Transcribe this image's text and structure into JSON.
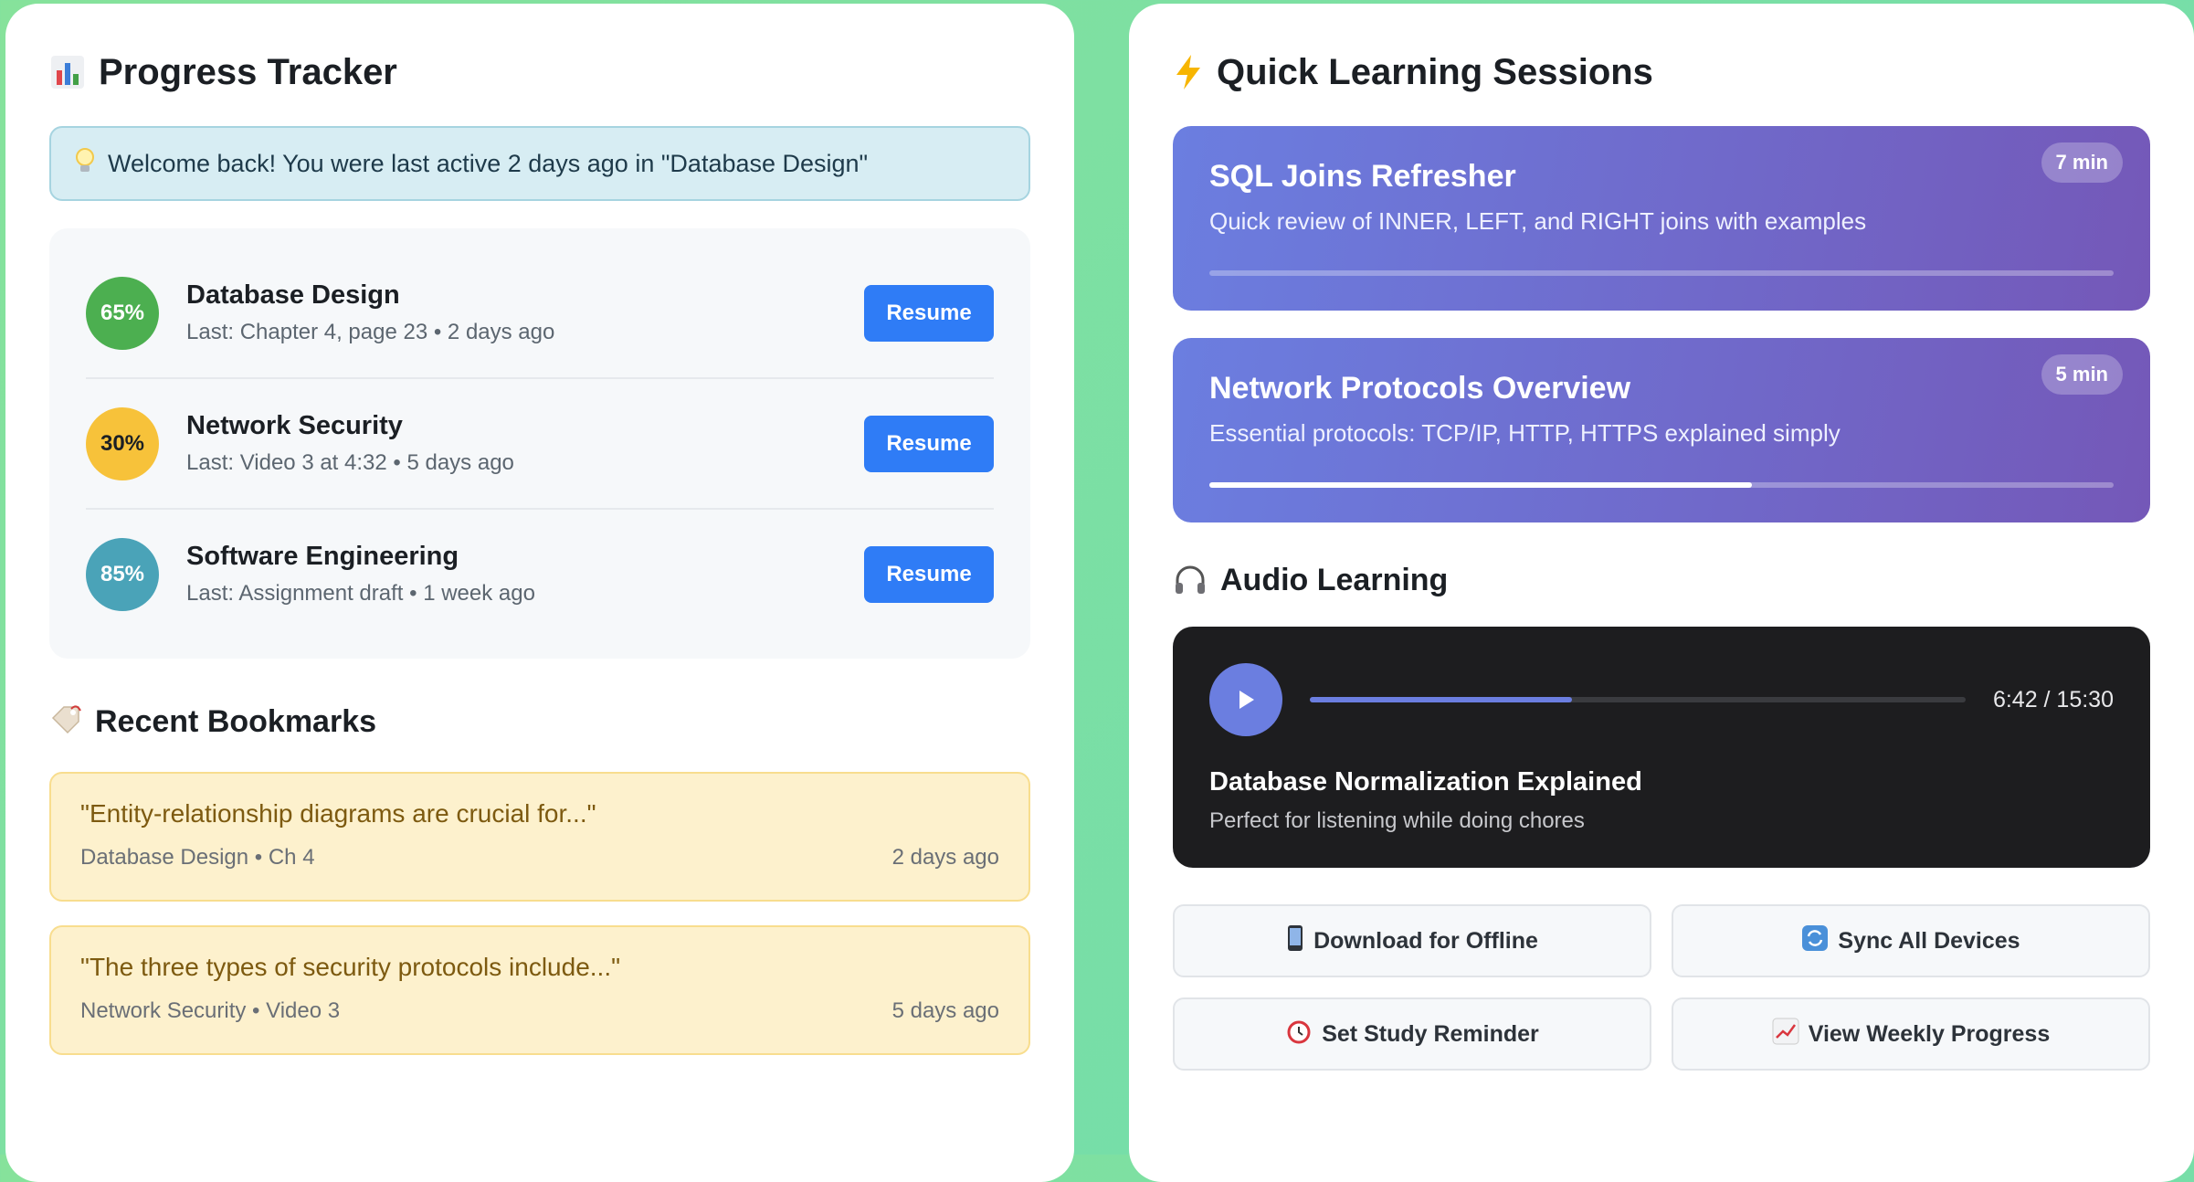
{
  "progress": {
    "title": "Progress Tracker",
    "icon": "bar-chart-icon",
    "welcome": "Welcome back! You were last active 2 days ago in \"Database Design\"",
    "courses": [
      {
        "percent": "65%",
        "name": "Database Design",
        "last": "Last: Chapter 4, page 23 • 2 days ago",
        "button": "Resume",
        "color": "#4caf50",
        "text_color": "#ffffff"
      },
      {
        "percent": "30%",
        "name": "Network Security",
        "last": "Last: Video 3 at 4:32 • 5 days ago",
        "button": "Resume",
        "color": "#f7c23a",
        "text_color": "#1b1f24"
      },
      {
        "percent": "85%",
        "name": "Software Engineering",
        "last": "Last: Assignment draft • 1 week ago",
        "button": "Resume",
        "color": "#4aa3b8",
        "text_color": "#ffffff"
      }
    ]
  },
  "bookmarks": {
    "title": "Recent Bookmarks",
    "icon": "bookmark-tag-icon",
    "items": [
      {
        "quote": "\"Entity-relationship diagrams are crucial for...\"",
        "source": "Database Design • Ch 4",
        "time": "2 days ago"
      },
      {
        "quote": "\"The three types of security protocols include...\"",
        "source": "Network Security • Video 3",
        "time": "5 days ago"
      }
    ]
  },
  "sessions": {
    "title": "Quick Learning Sessions",
    "icon": "lightning-icon",
    "items": [
      {
        "title": "SQL Joins Refresher",
        "desc": "Quick review of INNER, LEFT, and RIGHT joins with examples",
        "duration": "7 min",
        "progress": 0
      },
      {
        "title": "Network Protocols Overview",
        "desc": "Essential protocols: TCP/IP, HTTP, HTTPS explained simply",
        "duration": "5 min",
        "progress": 0.6
      }
    ]
  },
  "audio": {
    "title": "Audio Learning",
    "icon": "headphones-icon",
    "time": "6:42 / 15:30",
    "progress": 0.4,
    "track_title": "Database Normalization Explained",
    "track_desc": "Perfect for listening while doing chores"
  },
  "actions": [
    {
      "label": "Download for Offline",
      "icon": "phone-icon"
    },
    {
      "label": "Sync All Devices",
      "icon": "sync-icon"
    },
    {
      "label": "Set Study Reminder",
      "icon": "alarm-clock-icon"
    },
    {
      "label": "View Weekly Progress",
      "icon": "trend-chart-icon"
    }
  ]
}
